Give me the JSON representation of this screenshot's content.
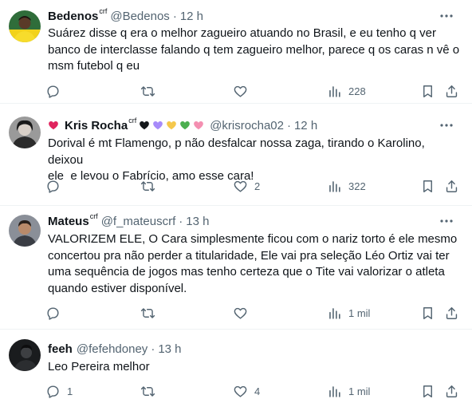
{
  "tweets": [
    {
      "name": "Bedenos",
      "name_sup": "crf",
      "handle": "@Bedenos",
      "dot": "·",
      "time": "12 h",
      "text": "Suárez disse q era o melhor zagueiro atuando no Brasil, e eu tenho q ver\nbanco de interclasse falando q tem zagueiro melhor, parece q os caras n vê o\nmsm futebol q eu",
      "replies": "",
      "retweets": "",
      "likes": "",
      "views": "228"
    },
    {
      "name": "Kris Rocha",
      "name_sup": "crf",
      "handle": "@krisrocha02",
      "dot": "·",
      "time": "12 h",
      "heart_colors": [
        "#e0245e",
        "#14171a",
        "#a78bfa",
        "#f5c84c",
        "#4caf50",
        "#f48fb1"
      ],
      "text": "Dorival é mt Flamengo, p não desfalcar nossa zaga, tirando o Karolino, deixou\nele  e levou o Fabrício, amo esse cara!",
      "replies": "",
      "retweets": "",
      "likes": "2",
      "views": "322"
    },
    {
      "name": "Mateus",
      "name_sup": "crf",
      "handle": "@f_mateuscrf",
      "dot": "·",
      "time": "13 h",
      "text": "VALORIZEM ELE, O Cara simplesmente ficou com o nariz torto é ele mesmo\nconcertou pra não perder a titularidade, Ele vai pra seleção Léo Ortiz vai ter\numa sequência de jogos mas tenho certeza que o Tite vai valorizar o atleta\nquando estiver disponível.",
      "replies": "",
      "retweets": "",
      "likes": "",
      "views": "1 mil"
    },
    {
      "name": "feeh",
      "name_sup": "",
      "handle": "@fefehdoney",
      "dot": "·",
      "time": "13 h",
      "text": "Leo Pereira melhor",
      "replies": "1",
      "retweets": "",
      "likes": "4",
      "views": "1 mil"
    }
  ]
}
